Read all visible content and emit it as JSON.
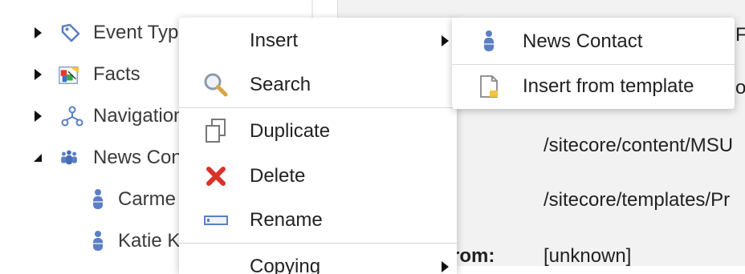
{
  "tree": {
    "items": [
      {
        "label": "Event Typ",
        "expander": "collapsed",
        "icon": "tag-icon"
      },
      {
        "label": "Facts",
        "expander": "collapsed",
        "icon": "facts-icon"
      },
      {
        "label": "Navigation",
        "expander": "collapsed",
        "icon": "navigation-icon"
      },
      {
        "label": "News Con",
        "expander": "expanded",
        "icon": "people-group-icon"
      },
      {
        "label": "Carme",
        "expander": "none",
        "icon": "person-icon"
      },
      {
        "label": "Katie K",
        "expander": "none",
        "icon": "person-icon"
      }
    ]
  },
  "content": {
    "partial_top_value": "F-",
    "partial_value_2": "o",
    "rows": [
      {
        "label": ":",
        "value": "/sitecore/content/MSU"
      },
      {
        "label": ":",
        "value": "/sitecore/templates/Pr"
      },
      {
        "label": "rom:",
        "value": "[unknown]"
      }
    ]
  },
  "context_menu": {
    "items": [
      {
        "label": "Insert",
        "icon": "none",
        "has_submenu": true
      },
      {
        "label": "Search",
        "icon": "magnifier-icon",
        "has_submenu": false
      },
      {
        "label": "Duplicate",
        "icon": "duplicate-icon",
        "has_submenu": false
      },
      {
        "label": "Delete",
        "icon": "delete-x-icon",
        "has_submenu": false
      },
      {
        "label": "Rename",
        "icon": "rename-icon",
        "has_submenu": false
      },
      {
        "label": "Copying",
        "icon": "none",
        "has_submenu": true
      }
    ]
  },
  "submenu": {
    "items": [
      {
        "label": "News Contact",
        "icon": "person-icon"
      },
      {
        "label": "Insert from template",
        "icon": "template-page-icon"
      }
    ]
  },
  "colors": {
    "person_blue": "#5b7fc4",
    "delete_red": "#d9322b",
    "content_bg": "#f2f2f2"
  }
}
